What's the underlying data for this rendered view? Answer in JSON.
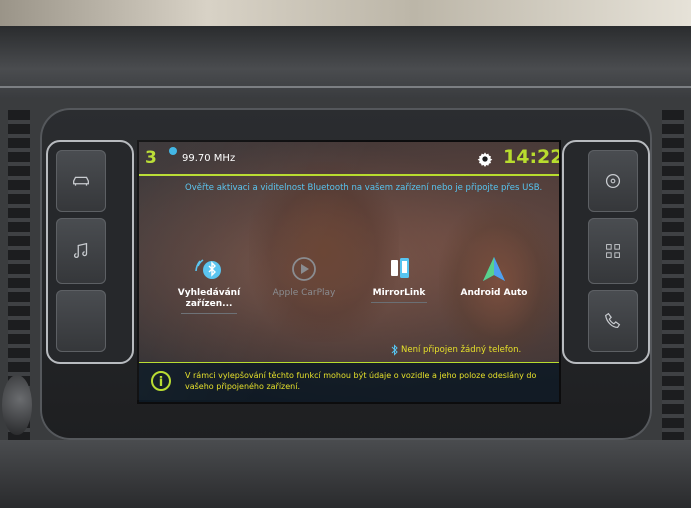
{
  "status_bar": {
    "temperature": "3",
    "temperature_unit": "c",
    "radio_frequency": "99.70 MHz",
    "clock": "14:22",
    "accent_color": "#b8dc2e"
  },
  "bluetooth_message": "Ověřte aktivaci a viditelnost Bluetooth na vašem zařízení nebo je připojte přes USB.",
  "apps": [
    {
      "label": "Vyhledávání zařízen...",
      "icon": "bluetooth-search-icon",
      "enabled": true
    },
    {
      "label": "Apple CarPlay",
      "icon": "carplay-icon",
      "enabled": false
    },
    {
      "label": "MirrorLink",
      "icon": "mirrorlink-icon",
      "enabled": true
    },
    {
      "label": "Android Auto",
      "icon": "android-auto-icon",
      "enabled": true
    }
  ],
  "connection_status": "Není připojen žádný telefon.",
  "info_message": "V rámci vylepšování těchto funkcí mohou být údaje o vozidle a jeho poloze odeslány do vašeho připojeného zařízení.",
  "hardware_buttons": {
    "left": [
      "car-icon",
      "music-note-icon",
      "blank"
    ],
    "right": [
      "settings-dial-icon",
      "apps-grid-icon",
      "phone-icon"
    ]
  }
}
